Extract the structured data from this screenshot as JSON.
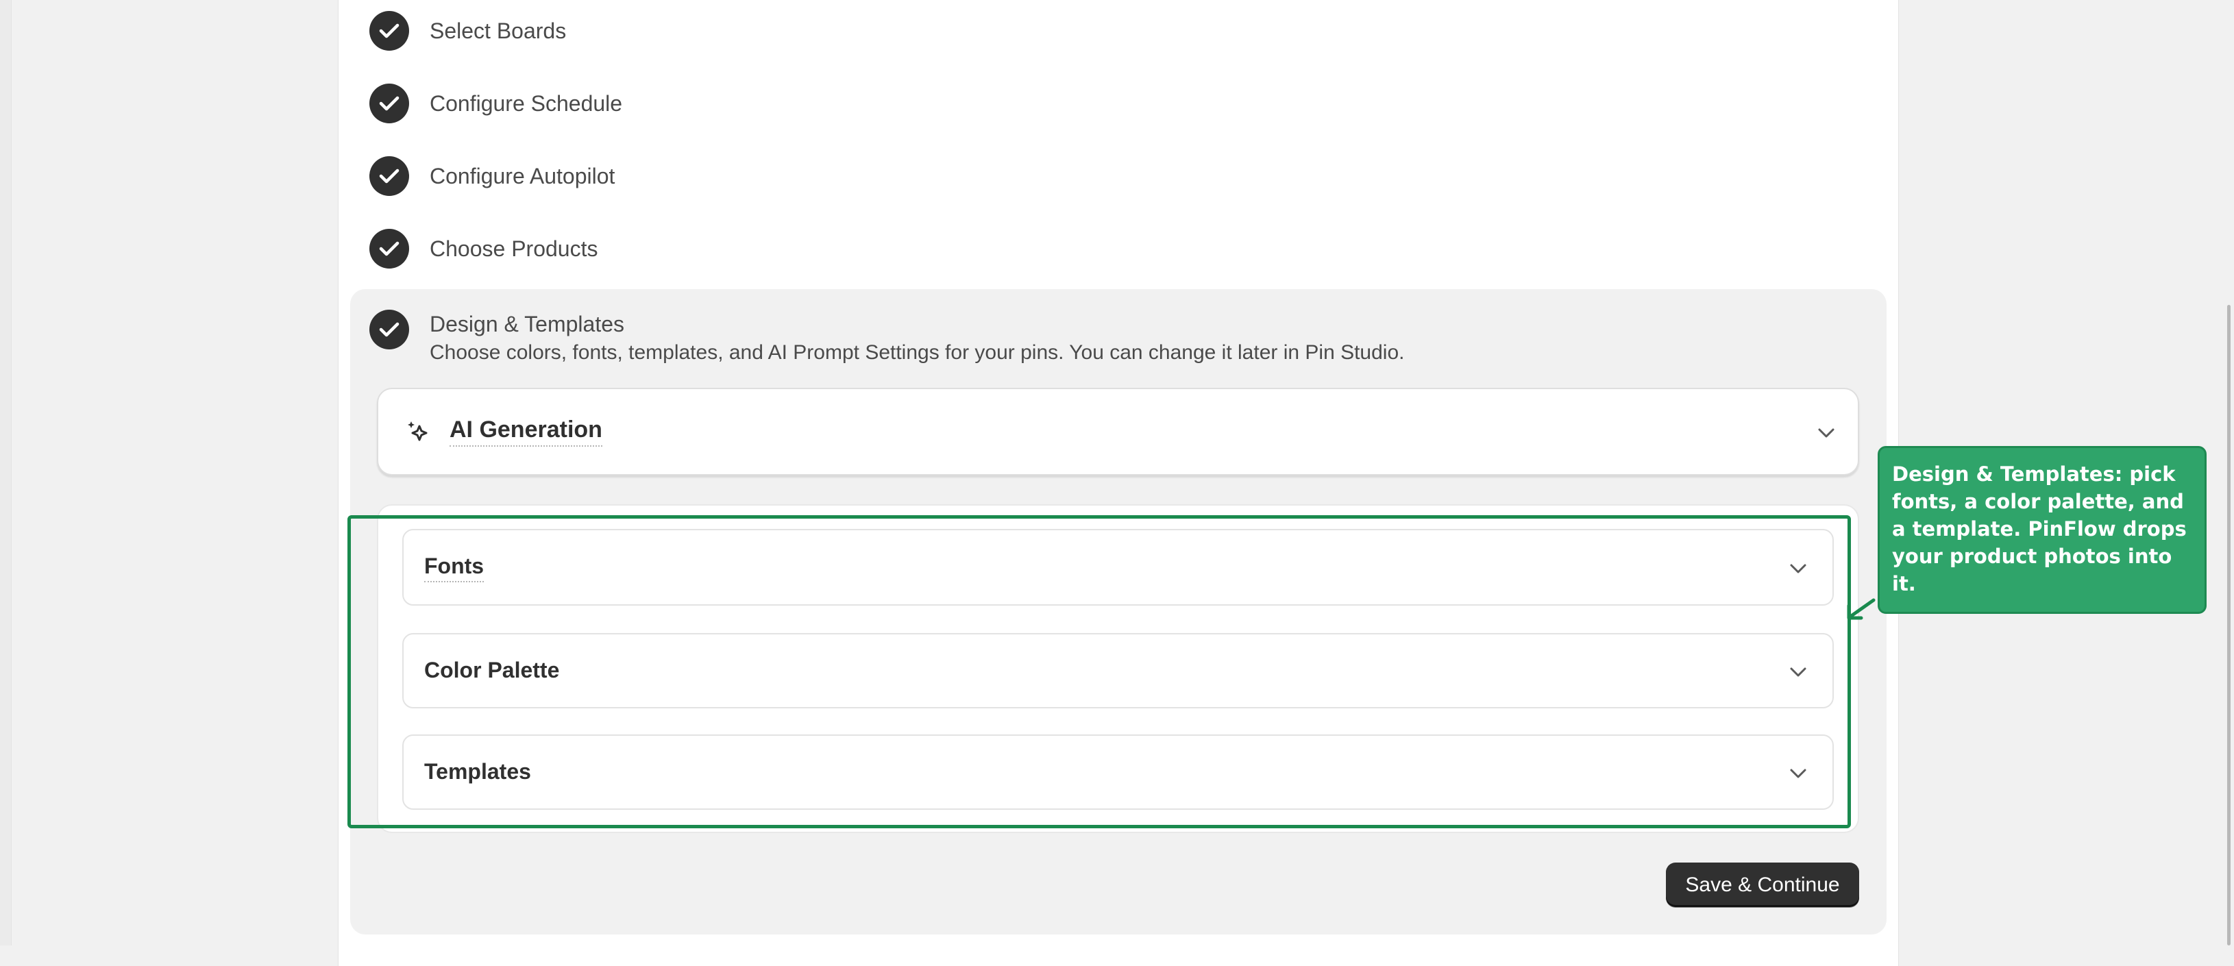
{
  "steps": [
    {
      "label": "Select Boards"
    },
    {
      "label": "Configure Schedule"
    },
    {
      "label": "Configure Autopilot"
    },
    {
      "label": "Choose Products"
    }
  ],
  "active_step": {
    "title": "Design & Templates",
    "description": "Choose colors, fonts, templates, and AI Prompt Settings for your pins. You can change it later in Pin Studio."
  },
  "ai_generation": {
    "title": "AI Generation",
    "icon": "sparkle-icon"
  },
  "sections": [
    {
      "title": "Fonts"
    },
    {
      "title": "Color Palette"
    },
    {
      "title": "Templates"
    }
  ],
  "tooltip": {
    "text": "Design & Templates: pick fonts, a color palette, and a template. PinFlow drops your product photos into it."
  },
  "buttons": {
    "save_continue": "Save & Continue"
  },
  "colors": {
    "accent_dark": "#303030",
    "highlight_green": "#1a8a4e",
    "tooltip_green": "#2fa46a",
    "panel_gray": "#f1f1f1"
  }
}
